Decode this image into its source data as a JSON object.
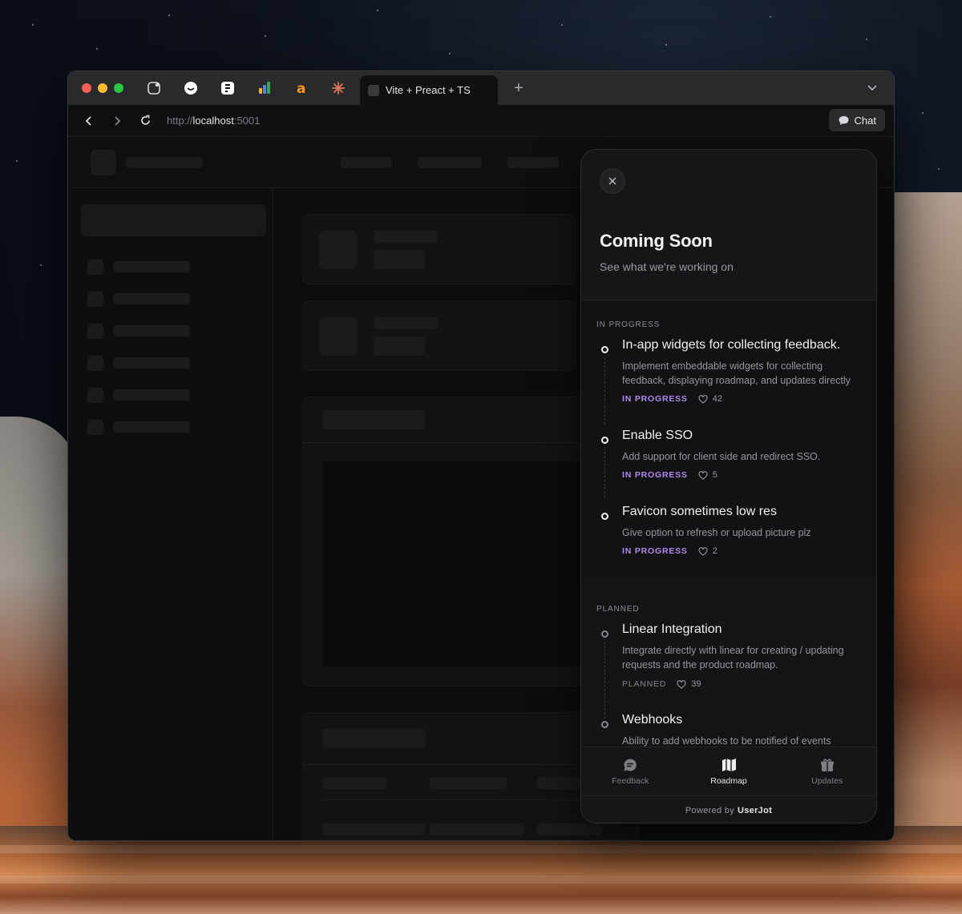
{
  "browser": {
    "active_tab_title": "Vite + Preact + TS",
    "new_tab_symbol": "+",
    "url_scheme": "http://",
    "url_host": "localhost",
    "url_port": ":5001",
    "chat_label": "Chat",
    "pinned_tabs": [
      "app-icon",
      "chat-bubble-icon",
      "figma-icon",
      "analytics-icon",
      "amazon-icon",
      "claude-icon"
    ]
  },
  "widget": {
    "title": "Coming Soon",
    "subtitle": "See what we're working on",
    "sections": [
      {
        "label": "IN PROGRESS",
        "items": [
          {
            "title": "In-app widgets for collecting feedback.",
            "description": "Implement embeddable widgets for collecting feedback, displaying roadmap, and updates directly in your app.",
            "status": "IN PROGRESS",
            "votes": "42"
          },
          {
            "title": "Enable SSO",
            "description": "Add support for client side and redirect SSO.",
            "status": "IN PROGRESS",
            "votes": "5"
          },
          {
            "title": "Favicon sometimes low res",
            "description": "Give option to refresh or upload picture plz",
            "status": "IN PROGRESS",
            "votes": "2"
          }
        ]
      },
      {
        "label": "PLANNED",
        "items": [
          {
            "title": "Linear Integration",
            "description": "Integrate directly with linear for creating / updating requests and the product roadmap.",
            "status": "PLANNED",
            "votes": "39"
          },
          {
            "title": "Webhooks",
            "description": "Ability to add webhooks to be notified of events",
            "status": "PLANNED",
            "votes": ""
          }
        ]
      }
    ],
    "nav": [
      {
        "label": "Feedback",
        "icon": "chat-bubble-icon",
        "active": false
      },
      {
        "label": "Roadmap",
        "icon": "map-icon",
        "active": true
      },
      {
        "label": "Updates",
        "icon": "gift-icon",
        "active": false
      }
    ],
    "powered_prefix": "Powered by",
    "powered_brand": "UserJot"
  },
  "colors": {
    "status_in_progress": "#b189ef",
    "status_planned": "#85858b",
    "widget_bg": "#161618"
  }
}
